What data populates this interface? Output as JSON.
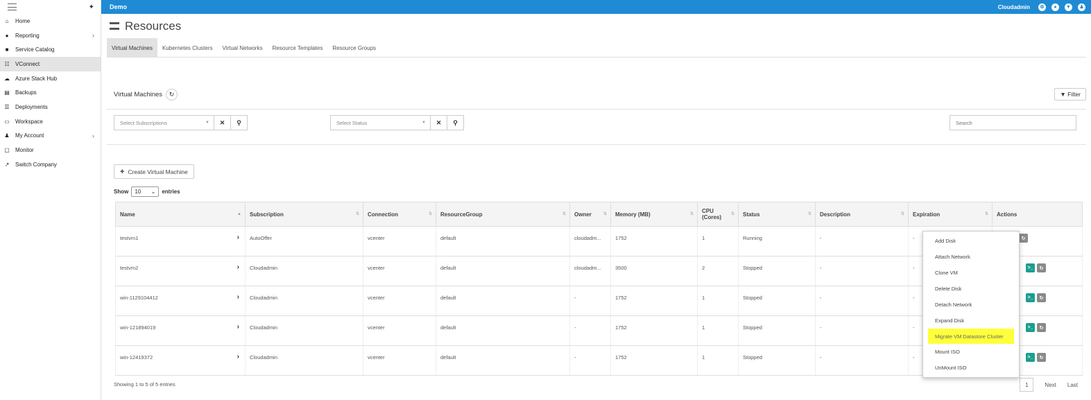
{
  "sidebar": {
    "items": [
      {
        "label": "Home",
        "icon": "home-icon",
        "glyph": "⌂",
        "arrow": false
      },
      {
        "label": "Reporting",
        "icon": "chart-icon",
        "glyph": "●",
        "arrow": true
      },
      {
        "label": "Service Catalog",
        "icon": "briefcase-icon",
        "glyph": "■",
        "arrow": false
      },
      {
        "label": "VConnect",
        "icon": "list-icon",
        "glyph": "☷",
        "arrow": false,
        "active": true
      },
      {
        "label": "Azure Stack Hub",
        "icon": "cloud-icon",
        "glyph": "☁",
        "arrow": false
      },
      {
        "label": "Backups",
        "icon": "database-icon",
        "glyph": "▤",
        "arrow": false
      },
      {
        "label": "Deployments",
        "icon": "server-icon",
        "glyph": "☰",
        "arrow": false
      },
      {
        "label": "Workspace",
        "icon": "printer-icon",
        "glyph": "▭",
        "arrow": false
      },
      {
        "label": "My Account",
        "icon": "user-icon",
        "glyph": "♟",
        "arrow": true
      },
      {
        "label": "Monitor",
        "icon": "monitor-icon",
        "glyph": "▢",
        "arrow": false
      },
      {
        "label": "Switch Company",
        "icon": "external-link-icon",
        "glyph": "↗",
        "arrow": false
      }
    ],
    "arrow_glyph": "›"
  },
  "topbar": {
    "title": "Demo",
    "user": "Cloudadmin"
  },
  "page": {
    "title": "Resources"
  },
  "tabs": [
    "Virtual Machines",
    "Kubernetes Clusters",
    "Virtual Networks",
    "Resource Templates",
    "Resource Groups"
  ],
  "panel": {
    "title": "Virtual Machines",
    "filter_label": "Filter"
  },
  "filters": {
    "subscriptions_placeholder": "Select Subscriptions",
    "status_placeholder": "Select Status",
    "search_placeholder": "Search"
  },
  "create_button": "Create Virtual Machine",
  "show": {
    "prefix": "Show",
    "value": "10",
    "suffix": "entries"
  },
  "table": {
    "headers": [
      "Name",
      "Subscription",
      "Connection",
      "ResourceGroup",
      "Owner",
      "Memory (MB)",
      "CPU (Cores)",
      "Status",
      "Description",
      "Expiration",
      "Actions"
    ],
    "rows": [
      {
        "name": "testvm1",
        "subscription": "AutoOffer",
        "connection": "vcenter",
        "group": "default",
        "owner": "cloudadm...",
        "memory": "1752",
        "cpu": "1",
        "status": "Running",
        "description": "-",
        "expiration": "-"
      },
      {
        "name": "testvm2",
        "subscription": "Cloudadmin",
        "connection": "vcenter",
        "group": "default",
        "owner": "cloudadm...",
        "memory": "3500",
        "cpu": "2",
        "status": "Stopped",
        "description": "-",
        "expiration": "-"
      },
      {
        "name": "win-1129104412",
        "subscription": "Cloudadmin",
        "connection": "vcenter",
        "group": "default",
        "owner": "-",
        "memory": "1752",
        "cpu": "1",
        "status": "Stopped",
        "description": "-",
        "expiration": "-"
      },
      {
        "name": "win-121894019",
        "subscription": "Cloudadmin",
        "connection": "vcenter",
        "group": "default",
        "owner": "-",
        "memory": "1752",
        "cpu": "1",
        "status": "Stopped",
        "description": "-",
        "expiration": "-"
      },
      {
        "name": "win-12419372",
        "subscription": "Cloudadmin",
        "connection": "vcenter",
        "group": "default",
        "owner": "-",
        "memory": "1752",
        "cpu": "1",
        "status": "Stopped",
        "description": "-",
        "expiration": "-"
      }
    ]
  },
  "footer": {
    "showing": "Showing 1 to 5 of 5 entries",
    "page": "1",
    "next": "Next",
    "last": "Last"
  },
  "context_menu": {
    "items": [
      "Add Disk",
      "Attach Network",
      "Clone VM",
      "Delete Disk",
      "Detach Network",
      "Expand Disk",
      "Migrate VM Datastore Cluster",
      "Mount ISO",
      "UnMount ISO"
    ],
    "highlighted": "Migrate VM Datastore Cluster"
  },
  "colors": {
    "topbar": "#1f8bd4",
    "highlight": "#ffff3c",
    "action_orange": "#f0a030",
    "action_teal": "#1a9e8f",
    "action_gray": "#8a8a8a"
  }
}
